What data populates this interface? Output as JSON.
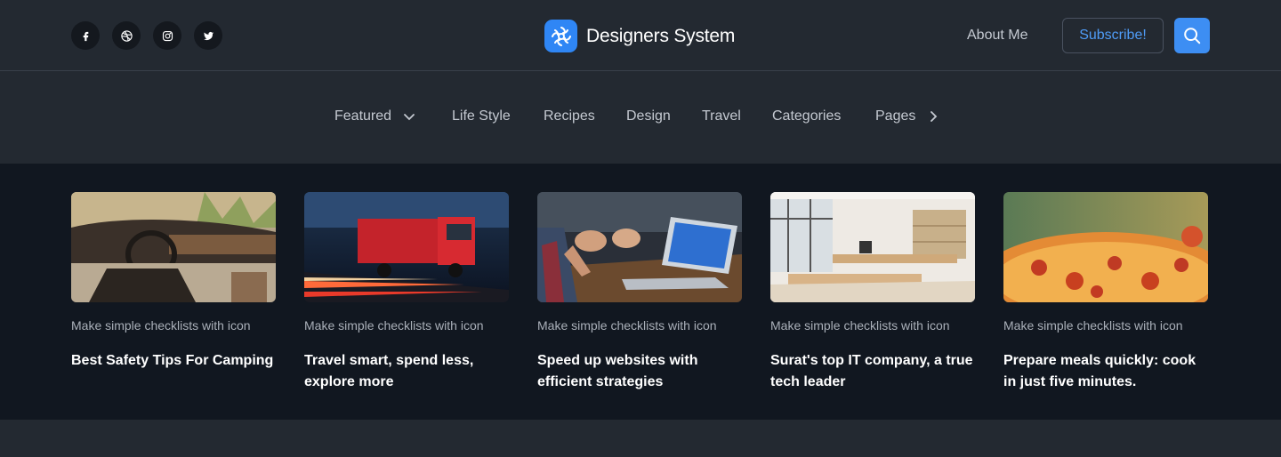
{
  "header": {
    "social_icons": [
      "facebook-icon",
      "dribbble-icon",
      "instagram-icon",
      "twitter-icon"
    ],
    "brand_name": "Designers System",
    "about_label": "About Me",
    "subscribe_label": "Subscribe!",
    "accent_color": "#3d8ef3"
  },
  "nav": {
    "items": [
      {
        "label": "Featured",
        "icon": "chevron-down-icon"
      },
      {
        "label": "Life Style"
      },
      {
        "label": "Recipes"
      },
      {
        "label": "Design"
      },
      {
        "label": "Travel"
      },
      {
        "label": "Categories"
      },
      {
        "label": "Pages",
        "icon": "chevron-right-icon"
      }
    ]
  },
  "cards": [
    {
      "image": "car interior",
      "meta": "Make simple checklists with icon",
      "title": "Best Safety Tips For Camping"
    },
    {
      "image": "red truck on highway",
      "meta": "Make simple checklists with icon",
      "title": "Travel smart, spend less, explore more"
    },
    {
      "image": "hands and laptop",
      "meta": "Make simple checklists with icon",
      "title": "Speed up websites with efficient strategies"
    },
    {
      "image": "bright office",
      "meta": "Make simple checklists with icon",
      "title": "Surat's top IT company, a true tech leader"
    },
    {
      "image": "pizza",
      "meta": "Make simple checklists with icon",
      "title": "Prepare meals quickly: cook in just five minutes."
    }
  ]
}
